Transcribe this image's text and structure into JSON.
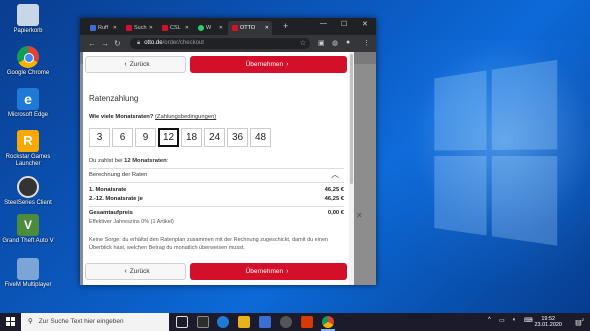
{
  "desktop": {
    "icons": [
      {
        "label": "Papierkorb",
        "color": "#c8d6e6"
      },
      {
        "label": "Google Chrome",
        "color": "#e8b21c"
      },
      {
        "label": "Microsoft Edge",
        "color": "#1f7ad6"
      },
      {
        "label": "Rockstar Games Launcher",
        "color": "#f7a900"
      },
      {
        "label": "SteelSeries Client",
        "color": "#333333"
      },
      {
        "label": "Grand Theft Auto V",
        "color": "#4a8b3c"
      },
      {
        "label": "FiveM Multiplayer",
        "color": "#7aa5d6"
      }
    ]
  },
  "browser": {
    "tabs": [
      {
        "label": "Ruff",
        "favicon_color": "#3b6fd6"
      },
      {
        "label": "Such",
        "favicon_color": "#d40f29"
      },
      {
        "label": "CSL",
        "favicon_color": "#d40f29"
      },
      {
        "label": "W",
        "favicon_color": "#25d366"
      },
      {
        "label": "OTTO",
        "favicon_color": "#d40f29"
      }
    ],
    "url_domain": "otto.de",
    "url_path": "/order/checkout"
  },
  "modal": {
    "back_label": "Zurück",
    "accept_label": "Übernehmen",
    "title": "Ratenzahlung",
    "question": "Wie viele Monatsraten?",
    "conditions_link": "(Zahlungsbedingungen)",
    "rate_options": [
      "3",
      "6",
      "9",
      "12",
      "18",
      "24",
      "36",
      "48"
    ],
    "selected_rate": "12",
    "pay_text_prefix": "Du zahlst bei",
    "pay_text_value": "12 Monatsraten",
    "pay_text_suffix": ":",
    "breakdown_label": "Berechnung der Raten",
    "first_rate_label": "1. Monatsrate",
    "first_rate_value": "46,25 €",
    "next_rate_label": "2.-12. Monatsrate je",
    "next_rate_value": "46,25 €",
    "total_surcharge_label": "Gesamtaufpreis",
    "total_surcharge_value": "0,00 €",
    "interest_label": "Effektiver Jahreszins 0% (1 Artikel)",
    "note": "Keine Sorge: du erhältst den Ratenplan zusammen mit der Rechnung zugeschickt, damit du einen Überblick hast, welchen Betrag du monatlich überweisen musst."
  },
  "taskbar": {
    "search_placeholder": "Zur Suche Text hier eingeben",
    "time": "19:52",
    "date": "23.01.2020",
    "notification_count": "2"
  }
}
